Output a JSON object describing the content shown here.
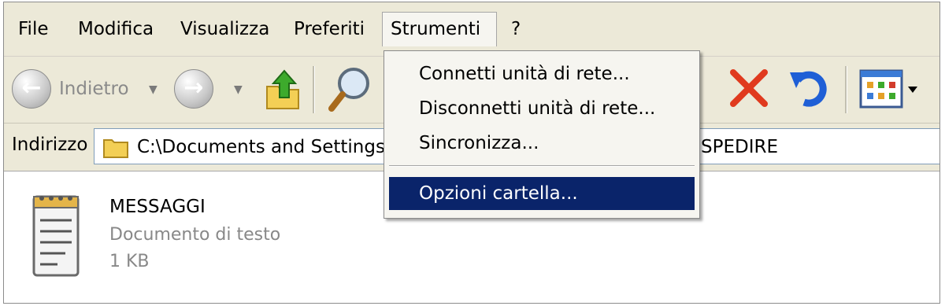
{
  "menubar": {
    "items": [
      {
        "label": "File"
      },
      {
        "label": "Modifica"
      },
      {
        "label": "Visualizza"
      },
      {
        "label": "Preferiti"
      },
      {
        "label": "Strumenti"
      },
      {
        "label": "?"
      }
    ]
  },
  "toolbar": {
    "back_label": "Indietro",
    "icons": [
      "back-arrow-icon",
      "forward-arrow-icon",
      "folder-up-icon",
      "search-icon",
      "delete-x-icon",
      "undo-icon",
      "views-icon"
    ],
    "colors": {
      "delete": "#e03a1e",
      "undo": "#1f5fd6"
    }
  },
  "address": {
    "label": "Indirizzo",
    "path_start": "C:\\Documents and Settings",
    "path_end": "SPEDIRE"
  },
  "dropdown": {
    "items": [
      {
        "label": "Connetti unità di rete..."
      },
      {
        "label": "Disconnetti unità di rete..."
      },
      {
        "label": "Sincronizza..."
      },
      {
        "label": "Opzioni cartella..."
      }
    ],
    "selected_color": "#0a246a"
  },
  "file": {
    "name": "MESSAGGI",
    "type": "Documento di testo",
    "size": "1 KB",
    "icon": "text-document-icon"
  }
}
